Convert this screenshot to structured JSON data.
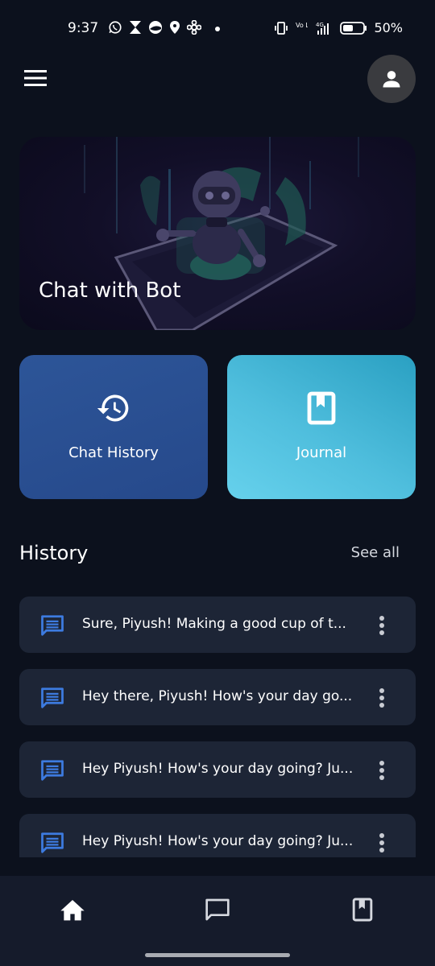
{
  "status_bar": {
    "time": "9:37",
    "left_icons": [
      "whatsapp-icon",
      "hourglass-icon",
      "app-icon",
      "location-icon",
      "pinwheel-icon",
      "dot-icon"
    ],
    "right_icons": [
      "vibrate-icon",
      "volte-icon",
      "signal-4g-icon",
      "battery-icon"
    ],
    "volte_label": "Vo LTE",
    "network_label": "4G",
    "battery": "50%"
  },
  "header": {
    "menu_icon": "hamburger-menu-icon",
    "profile_icon": "person-icon"
  },
  "hero": {
    "title": "Chat with Bot"
  },
  "tiles": [
    {
      "label": "Chat History",
      "icon": "history-icon",
      "color": "#2b5194"
    },
    {
      "label": "Journal",
      "icon": "bookmark-book-icon",
      "color": "#4dbfdf"
    }
  ],
  "history": {
    "title": "History",
    "see_all": "See all",
    "items": [
      {
        "text": "Sure, Piyush! Making a good cup of t..."
      },
      {
        "text": "Hey there, Piyush! How's your day go..."
      },
      {
        "text": "Hey Piyush! How's your day going? Ju..."
      },
      {
        "text": "Hey Piyush! How's your day going? Ju..."
      }
    ]
  },
  "bottom_nav": {
    "items": [
      "home-icon",
      "chat-icon",
      "journal-icon"
    ]
  },
  "colors": {
    "background": "#0c111d",
    "card": "#1d2536",
    "accent_blue": "#3d7be0",
    "nav": "#151b2b"
  }
}
